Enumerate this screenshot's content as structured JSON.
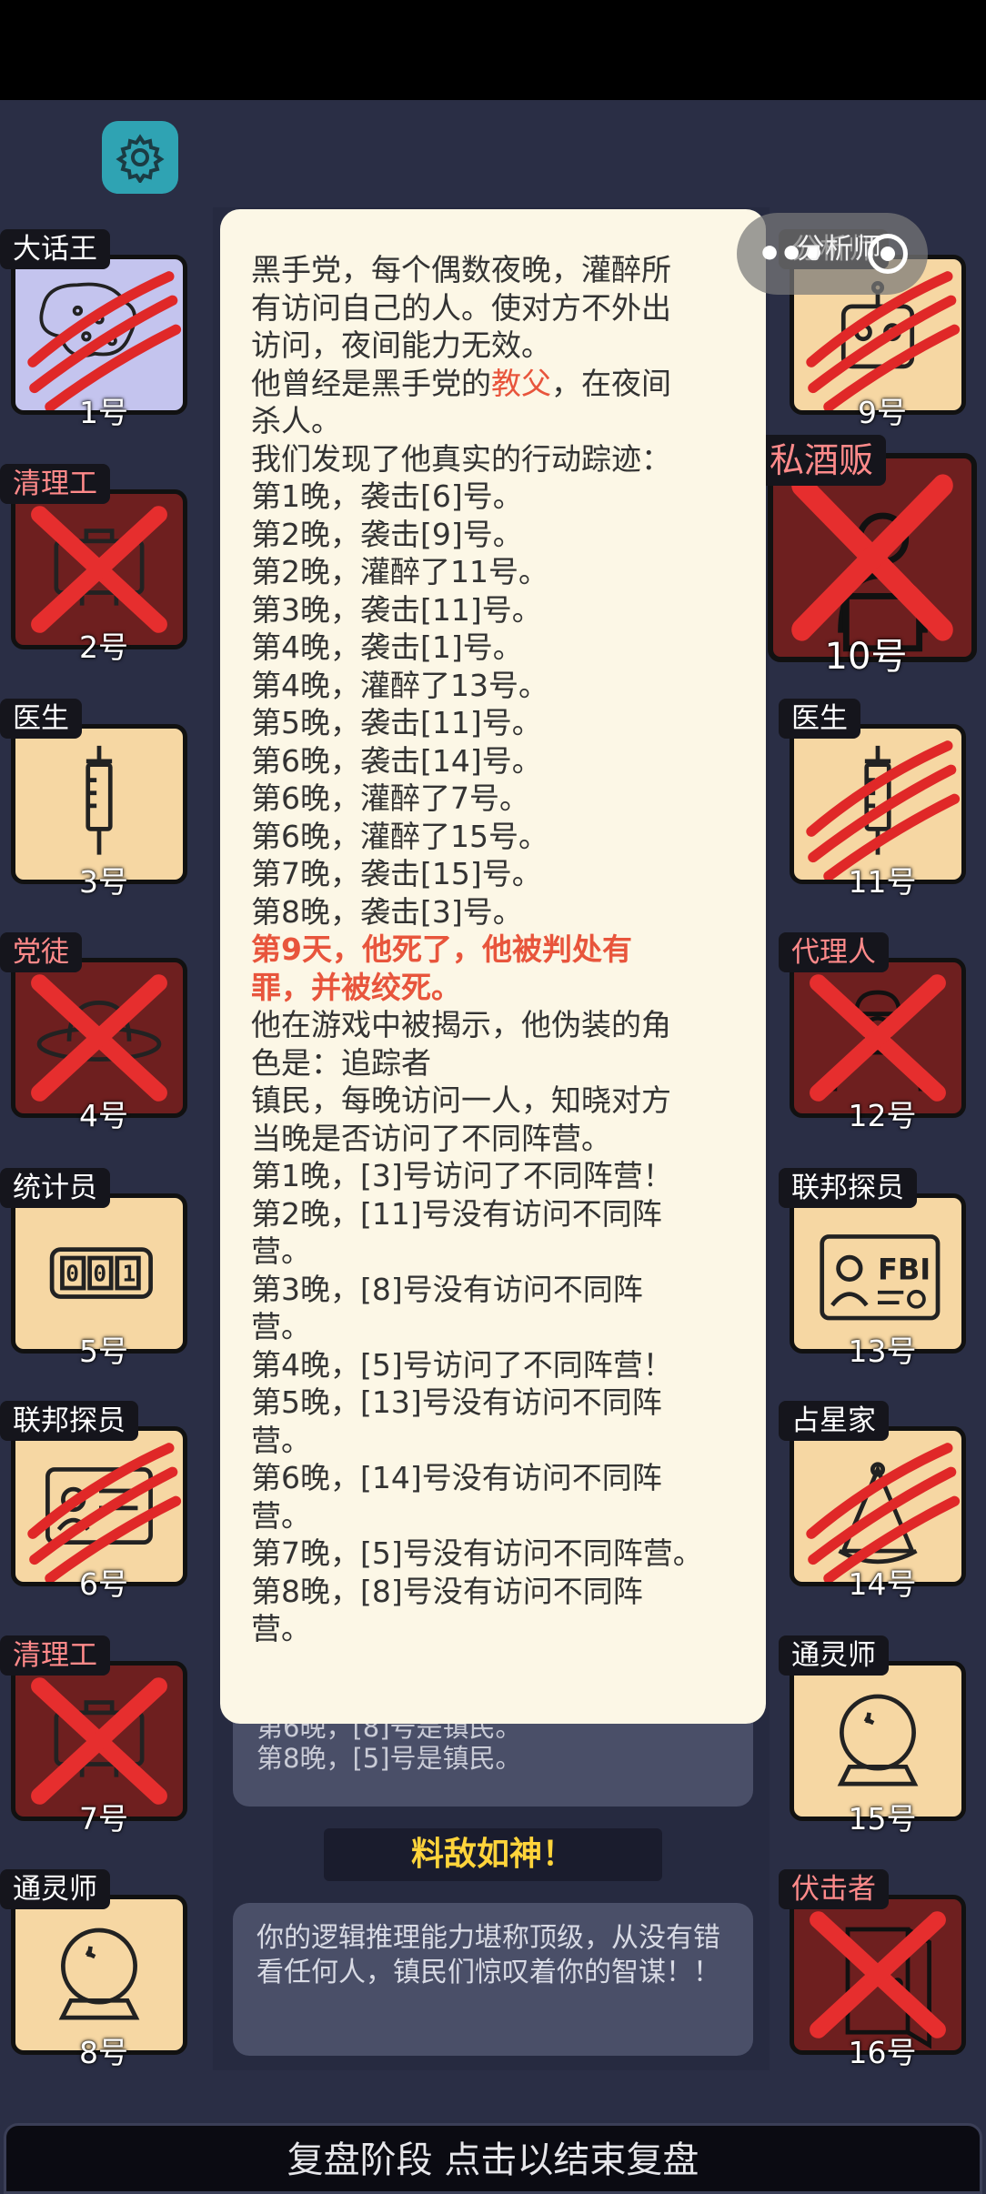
{
  "header": {
    "settings_icon": "gear-icon",
    "accent": "#2fa3b3"
  },
  "players_left": [
    {
      "role": "大话王",
      "number": "1号",
      "state": "clawed",
      "tile": "purple",
      "icon": "brain-icon"
    },
    {
      "role": "清理工",
      "number": "2号",
      "state": "crossed",
      "tile": "dark",
      "role_color": "red",
      "icon": "toolbox-icon"
    },
    {
      "role": "医生",
      "number": "3号",
      "state": "alive",
      "tile": "light",
      "icon": "syringe-icon"
    },
    {
      "role": "党徒",
      "number": "4号",
      "state": "crossed",
      "tile": "dark",
      "role_color": "red",
      "icon": "hat-icon"
    },
    {
      "role": "统计员",
      "number": "5号",
      "state": "alive",
      "tile": "light",
      "icon": "counter-icon"
    },
    {
      "role": "联邦探员",
      "number": "6号",
      "state": "clawed",
      "tile": "light",
      "icon": "badge-icon"
    },
    {
      "role": "清理工",
      "number": "7号",
      "state": "crossed",
      "tile": "dark",
      "role_color": "red",
      "icon": "toolbox-icon"
    },
    {
      "role": "通灵师",
      "number": "8号",
      "state": "alive",
      "tile": "light",
      "icon": "crystal-ball-icon"
    }
  ],
  "players_right": [
    {
      "role": "分析师",
      "number": "9号",
      "state": "clawed",
      "tile": "light",
      "icon": "robot-icon"
    },
    {
      "role": "私酒贩",
      "number": "10号",
      "state": "crossed",
      "tile": "dark",
      "role_color": "red",
      "icon": "barrel-icon"
    },
    {
      "role": "医生",
      "number": "11号",
      "state": "clawed",
      "tile": "light",
      "icon": "syringe-icon"
    },
    {
      "role": "代理人",
      "number": "12号",
      "state": "crossed",
      "tile": "dark",
      "role_color": "red",
      "icon": "agent-icon"
    },
    {
      "role": "联邦探员",
      "number": "13号",
      "state": "alive",
      "tile": "light",
      "icon": "fbi-badge-icon"
    },
    {
      "role": "占星家",
      "number": "14号",
      "state": "clawed",
      "tile": "light",
      "icon": "sextant-icon"
    },
    {
      "role": "通灵师",
      "number": "15号",
      "state": "alive",
      "tile": "light",
      "icon": "crystal-ball-icon"
    },
    {
      "role": "伏击者",
      "number": "16号",
      "state": "crossed",
      "tile": "dark",
      "role_color": "red",
      "icon": "door-icon"
    }
  ],
  "analyst_pill": {
    "label": "分析师",
    "menu_icon": "more-dots-icon",
    "target_icon": "target-icon"
  },
  "popup": {
    "lines": [
      {
        "text": "黑手党，每个偶数夜晚，灌醉所"
      },
      {
        "text": "有访问自己的人。使对方不外出"
      },
      {
        "text": "访问，夜间能力无效。"
      },
      {
        "pre": "他曾经是黑手党的",
        "hl": "教父",
        "post": "，在夜间"
      },
      {
        "text": "杀人。"
      },
      {
        "text": "我们发现了他真实的行动踪迹："
      },
      {
        "text": "第1晚，袭击[6]号。"
      },
      {
        "text": "第2晚，袭击[9]号。"
      },
      {
        "text": "第2晚，灌醉了11号。"
      },
      {
        "text": "第3晚，袭击[11]号。"
      },
      {
        "text": "第4晚，袭击[1]号。"
      },
      {
        "text": "第4晚，灌醉了13号。"
      },
      {
        "text": "第5晚，袭击[11]号。"
      },
      {
        "text": "第6晚，袭击[14]号。"
      },
      {
        "text": "第6晚，灌醉了7号。"
      },
      {
        "text": "第6晚，灌醉了15号。"
      },
      {
        "text": "第7晚，袭击[15]号。"
      },
      {
        "text": "第8晚，袭击[3]号。"
      },
      {
        "death": "第9天，他死了，他被判处有"
      },
      {
        "death": "罪，并被绞死。"
      },
      {
        "text": "他在游戏中被揭示，他伪装的角"
      },
      {
        "text": "色是：追踪者"
      },
      {
        "text": "镇民，每晚访问一人，知晓对方"
      },
      {
        "text": "当晚是否访问了不同阵营。"
      },
      {
        "text": "第1晚，[3]号访问了不同阵营！"
      },
      {
        "text": "第2晚，[11]号没有访问不同阵"
      },
      {
        "text": "营。"
      },
      {
        "text": "第3晚，[8]号没有访问不同阵"
      },
      {
        "text": "营。"
      },
      {
        "text": "第4晚，[5]号访问了不同阵营！"
      },
      {
        "text": "第5晚，[13]号没有访问不同阵"
      },
      {
        "text": "营。"
      },
      {
        "text": "第6晚，[14]号没有访问不同阵"
      },
      {
        "text": "营。"
      },
      {
        "text": "第7晚，[5]号没有访问不同阵营。"
      },
      {
        "text": "第8晚，[8]号没有访问不同阵"
      },
      {
        "text": "营。"
      }
    ]
  },
  "hidden_log": {
    "line1": "第6晚，[8]号是镇民。",
    "line2": "第8晚，[5]号是镇民。"
  },
  "verdict": "料敌如神！",
  "comment": "你的逻辑推理能力堪称顶级，从没有错看任何人，镇民们惊叹着你的智谋！！",
  "footer": {
    "label": "复盘阶段 点击以结束复盘"
  },
  "colors": {
    "background": "#2a2e45",
    "popup": "#fcf7e6",
    "highlight": "#e8553c",
    "verdict": "#ffd43b",
    "dead_tile": "#6e1f1f",
    "alive_tile": "#f6d7a3"
  }
}
